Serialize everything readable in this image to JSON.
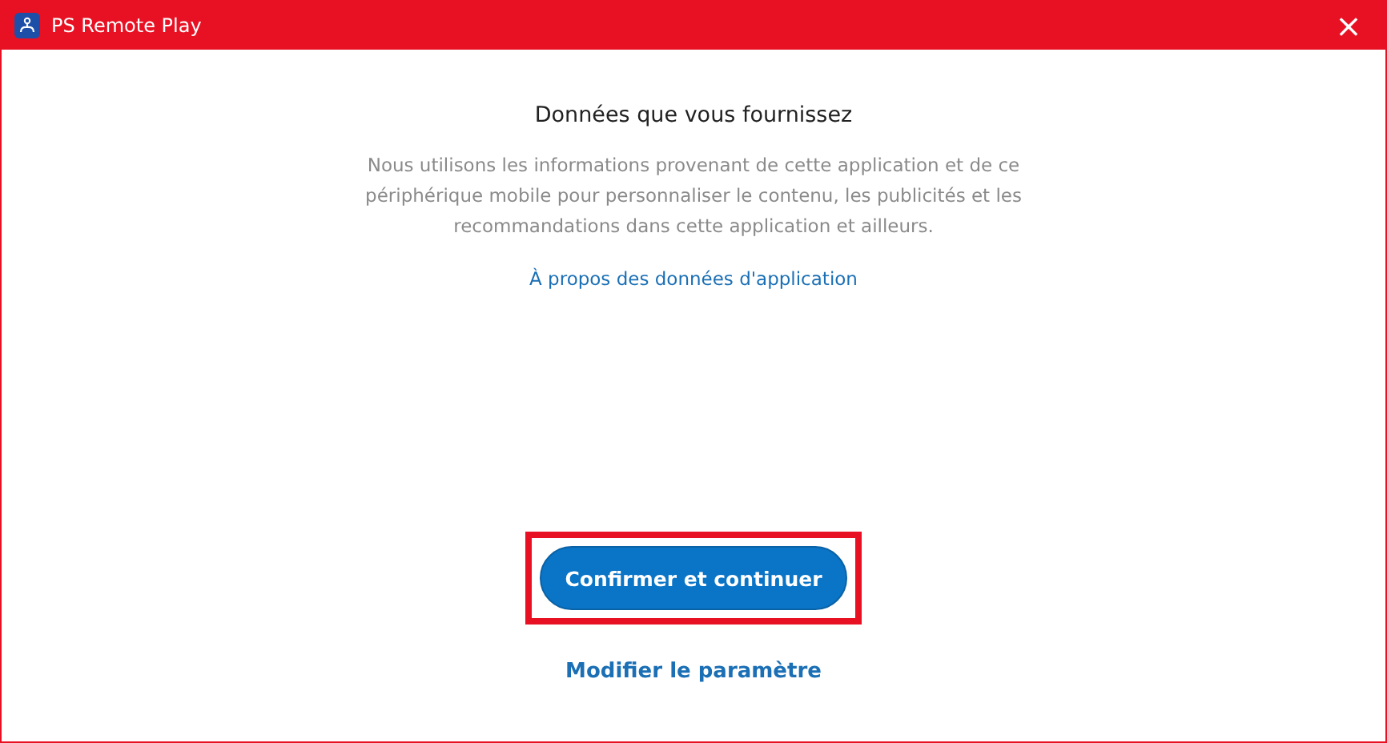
{
  "window": {
    "title": "PS Remote Play",
    "close": "×"
  },
  "content": {
    "heading": "Données que vous fournissez",
    "description": "Nous utilisons les informations provenant de cette application et de ce périphérique mobile pour personnaliser le contenu, les publicités et les recommandations dans cette application et ailleurs.",
    "link": "À propos des données d'application"
  },
  "primary_button": {
    "label": "Confirmer et continuer",
    "highlighted": true
  },
  "secondary_link": "Modifier le paramètre"
}
